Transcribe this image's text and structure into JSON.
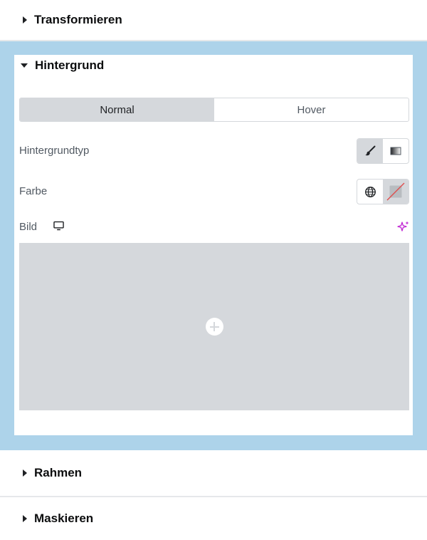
{
  "sections": {
    "transform": "Transformieren",
    "background": "Hintergrund",
    "border": "Rahmen",
    "mask": "Maskieren"
  },
  "state_tabs": {
    "normal": "Normal",
    "hover": "Hover",
    "selected": "Normal"
  },
  "controls": {
    "background_type_label": "Hintergrundtyp",
    "color_label": "Farbe",
    "image_label": "Bild"
  },
  "colors": {
    "accent_frame": "#add3ea",
    "ai_icon": "#c026d3",
    "no_color_slash": "#e04b4b"
  },
  "icons": {
    "background_type": [
      "brush-icon",
      "gradient-icon"
    ],
    "color": [
      "globe-icon",
      "no-color-icon"
    ],
    "image": [
      "desktop-icon",
      "ai-sparkle-icon",
      "add-circle-icon"
    ]
  }
}
